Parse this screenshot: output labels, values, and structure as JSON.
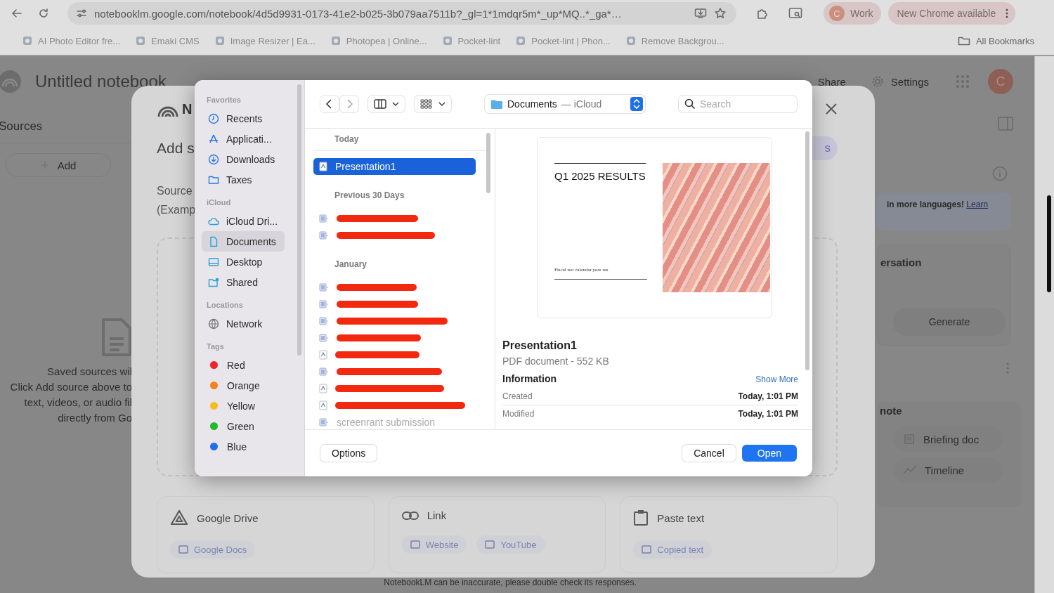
{
  "browser": {
    "url": "notebooklm.google.com/notebook/4d5d9931-0173-41e2-b025-3b079aa7511b?_gl=1*1mdqr5m*_up*MQ..*_ga*…",
    "profile": {
      "initial": "C",
      "label": "Work"
    },
    "update_chip": "New Chrome available",
    "bookmarks": [
      "AI Photo Editor fre...",
      "Emaki CMS",
      "Image Resizer | Ea...",
      "Photopea | Online...",
      "Pocket-lint",
      "Pocket-lint | Phon...",
      "Remove Backgrou..."
    ],
    "all_bookmarks": "All Bookmarks"
  },
  "notebook": {
    "title": "Untitled notebook",
    "share": "Share",
    "settings": "Settings",
    "avatar": "C",
    "sources_title": "Sources",
    "add_button": "Add",
    "empty_text": [
      "Saved sources wil",
      "Click Add source above to",
      "text, videos, or audio fil",
      "directly from Go"
    ],
    "notice": "in more languages!",
    "notice_link": "Learn",
    "section_1": "ersation",
    "generate": "Generate",
    "section_2": "note",
    "note_buttons": [
      {
        "kind": "doc",
        "label": "Briefing doc"
      },
      {
        "kind": "timeline",
        "label": "Timeline"
      }
    ],
    "footer": "NotebookLM can be inaccurate, please double check its responses."
  },
  "modal": {
    "logo_text": "N",
    "title": "Add s",
    "description": [
      "Source",
      "(Examp"
    ],
    "pill_text": "s",
    "cards": [
      {
        "kind": "drive",
        "title": "Google Drive",
        "chips": [
          "Google Docs"
        ]
      },
      {
        "kind": "link",
        "title": "Link",
        "chips": [
          "Website",
          "YouTube"
        ]
      },
      {
        "kind": "paste",
        "title": "Paste text",
        "chips": [
          "Copied text"
        ]
      }
    ]
  },
  "file_dialog": {
    "sidebar": [
      {
        "heading": "Favorites",
        "items": [
          {
            "kind": "place",
            "label": "Recents",
            "selected": false
          },
          {
            "kind": "place",
            "label": "Applicati...",
            "selected": false
          },
          {
            "kind": "place",
            "label": "Downloads",
            "selected": false
          },
          {
            "kind": "place",
            "label": "Taxes",
            "selected": false
          }
        ]
      },
      {
        "heading": "iCloud",
        "items": [
          {
            "kind": "place",
            "label": "iCloud Dri...",
            "selected": false
          },
          {
            "kind": "place",
            "label": "Documents",
            "selected": true
          },
          {
            "kind": "place",
            "label": "Desktop",
            "selected": false
          },
          {
            "kind": "place",
            "label": "Shared",
            "selected": false
          }
        ]
      },
      {
        "heading": "Locations",
        "items": [
          {
            "kind": "place",
            "label": "Network",
            "selected": false
          }
        ]
      },
      {
        "heading": "Tags",
        "items": [
          {
            "kind": "tag",
            "label": "Red",
            "color": "#f2222b",
            "selected": false
          },
          {
            "kind": "tag",
            "label": "Orange",
            "color": "#f5821f",
            "selected": false
          },
          {
            "kind": "tag",
            "label": "Yellow",
            "color": "#f5bd1f",
            "selected": false
          },
          {
            "kind": "tag",
            "label": "Green",
            "color": "#23b82c",
            "selected": false
          },
          {
            "kind": "tag",
            "label": "Blue",
            "color": "#1e6ff0",
            "selected": false
          }
        ]
      }
    ],
    "location": "Documents",
    "location_suffix": "— iCloud",
    "search_placeholder": "Search",
    "groups": [
      {
        "heading": "Today",
        "files": [
          {
            "kind": "pdf",
            "name": "Presentation1",
            "redacted": false,
            "selected": true
          }
        ]
      },
      {
        "heading": "Previous 30 Days",
        "files": [
          {
            "kind": "doc",
            "redacted": true,
            "selected": false
          },
          {
            "kind": "doc",
            "redacted": true,
            "selected": false
          }
        ]
      },
      {
        "heading": "January",
        "files": [
          {
            "kind": "doc",
            "redacted": true,
            "selected": false
          },
          {
            "kind": "doc",
            "redacted": true,
            "selected": false
          },
          {
            "kind": "doc",
            "redacted": true,
            "selected": false
          },
          {
            "kind": "doc",
            "redacted": true,
            "selected": false
          },
          {
            "kind": "pdf",
            "redacted": true,
            "selected": false
          },
          {
            "kind": "doc",
            "redacted": true,
            "selected": false
          },
          {
            "kind": "pdf",
            "redacted": true,
            "selected": false
          },
          {
            "kind": "pdf",
            "redacted": true,
            "selected": false
          },
          {
            "kind": "doc",
            "name": "screenrant submission",
            "redacted": false,
            "selected": false
          }
        ]
      }
    ],
    "preview": {
      "slide_title": "Q1 2025 RESULTS",
      "slide_subtitle": "Fiscal not calendar year res",
      "name": "Presentation1",
      "info": "PDF document - 552 KB",
      "info_heading": "Information",
      "show_more": "Show More",
      "rows": [
        {
          "label": "Created",
          "value": "Today, 1:01 PM"
        },
        {
          "label": "Modified",
          "value": "Today, 1:01 PM"
        }
      ]
    },
    "buttons": {
      "options": "Options",
      "cancel": "Cancel",
      "open": "Open"
    }
  }
}
